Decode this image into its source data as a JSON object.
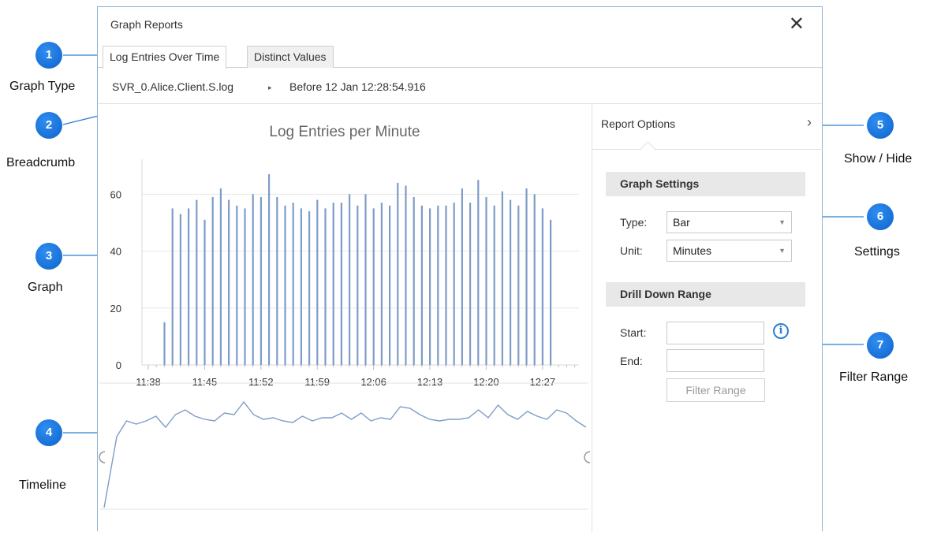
{
  "window": {
    "title": "Graph Reports",
    "close_glyph": "✕"
  },
  "tabs": [
    {
      "label": "Log Entries Over Time",
      "active": true
    },
    {
      "label": "Distinct Values",
      "active": false
    }
  ],
  "breadcrumb": {
    "file": "SVR_0.Alice.Client.S.log",
    "separator": "▸",
    "range": "Before 12 Jan 12:28:54.916"
  },
  "chart_data": {
    "type": "bar",
    "title": "Log Entries per Minute",
    "xlabel": "",
    "ylabel": "",
    "x_ticks": [
      "11:38",
      "11:45",
      "11:52",
      "11:59",
      "12:06",
      "12:13",
      "12:20",
      "12:27"
    ],
    "y_ticks": [
      0,
      20,
      40,
      60
    ],
    "ylim": [
      0,
      72
    ],
    "bar_color": "#7e9cc8",
    "categories": [
      "11:41",
      "11:42",
      "11:43",
      "11:44",
      "11:45",
      "11:46",
      "11:47",
      "11:48",
      "11:49",
      "11:50",
      "11:51",
      "11:52",
      "11:53",
      "11:54",
      "11:55",
      "11:56",
      "11:57",
      "11:58",
      "11:59",
      "12:00",
      "12:01",
      "12:02",
      "12:03",
      "12:04",
      "12:05",
      "12:06",
      "12:07",
      "12:08",
      "12:09",
      "12:10",
      "12:11",
      "12:12",
      "12:13",
      "12:14",
      "12:15",
      "12:16",
      "12:17",
      "12:18",
      "12:19",
      "12:20",
      "12:21",
      "12:22",
      "12:23",
      "12:24",
      "12:25",
      "12:26",
      "12:27",
      "12:28"
    ],
    "values": [
      15,
      55,
      53,
      55,
      58,
      51,
      59,
      62,
      58,
      56,
      55,
      60,
      59,
      67,
      59,
      56,
      57,
      55,
      54,
      58,
      55,
      57,
      57,
      60,
      56,
      60,
      55,
      57,
      56,
      64,
      63,
      59,
      56,
      55,
      56,
      56,
      57,
      62,
      57,
      65,
      59,
      56,
      61,
      58,
      56,
      62,
      60,
      55,
      51
    ]
  },
  "timeline": {
    "color": "#7e9cc8"
  },
  "report_options": {
    "header": "Report Options",
    "toggle_glyph": "›",
    "graph_settings": {
      "title": "Graph Settings",
      "type_label": "Type:",
      "type_value": "Bar",
      "unit_label": "Unit:",
      "unit_value": "Minutes",
      "caret": "▼"
    },
    "drill_down": {
      "title": "Drill Down Range",
      "start_label": "Start:",
      "start_value": "",
      "end_label": "End:",
      "end_value": "",
      "info_glyph": "i",
      "filter_button": "Filter Range"
    }
  },
  "callouts": [
    {
      "number": "1",
      "label": "Graph Type"
    },
    {
      "number": "2",
      "label": "Breadcrumb"
    },
    {
      "number": "3",
      "label": "Graph"
    },
    {
      "number": "4",
      "label": "Timeline"
    },
    {
      "number": "5",
      "label": "Show / Hide"
    },
    {
      "number": "6",
      "label": "Settings"
    },
    {
      "number": "7",
      "label": "Filter Range"
    }
  ]
}
